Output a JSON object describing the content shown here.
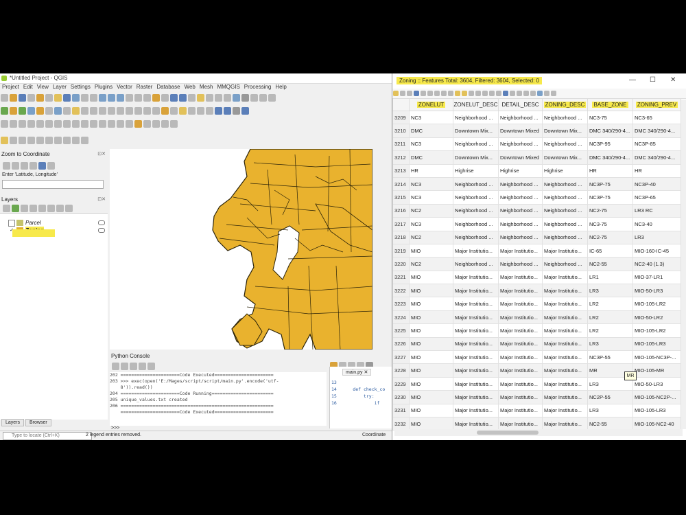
{
  "qgis": {
    "title": "*Untitled Project - QGIS",
    "menu": [
      "Project",
      "Edit",
      "View",
      "Layer",
      "Settings",
      "Plugins",
      "Vector",
      "Raster",
      "Database",
      "Web",
      "Mesh",
      "MMQGIS",
      "Processing",
      "Help"
    ],
    "zoom_panel_title": "Zoom to Coordinate",
    "zoom_input_label": "Enter 'Latitude, Longitude'",
    "layers_panel_title": "Layers",
    "layers": [
      {
        "name": "Parcel",
        "checked": false,
        "color": "#c4c36a"
      },
      {
        "name": "Zoning",
        "checked": true,
        "color": "#e2b22c"
      }
    ],
    "tabs": [
      "Layers",
      "Browser"
    ],
    "locator_placeholder": "Type to locate (Ctrl+K)",
    "status_message": "2 legend entries removed.",
    "coordinate_label": "Coordinate",
    "python_console_title": "Python Console",
    "console_lines": [
      "202 ======================Code Executed======================",
      "203 >>> exec(open('E:/Mages/script/script/main.py'.encode('utf-",
      "    8')).read())",
      "204 ======================Code Running=======================",
      "205 unique_values.txt created",
      "206 =========================================================",
      "    ======================Code Executed======================"
    ],
    "console_prompt": ">>>",
    "editor_tab": "main.py",
    "editor_lines": [
      "13",
      "14      def check_co",
      "15          try:",
      "16              if"
    ],
    "map_fill": "#e9b22e"
  },
  "attr": {
    "title": "Zoning :: Features Total: 3604, Filtered: 3604, Selected: 0",
    "columns": [
      "ZONELUT",
      "ZONELUT_DESC",
      "DETAIL_DESC",
      "ZONING_DESC",
      "BASE_ZONE",
      "ZONING_PREV"
    ],
    "highlighted_columns": [
      0,
      3,
      4,
      5
    ],
    "rows": [
      [
        "3209",
        "NC3",
        "Neighborhood ...",
        "Neighborhood ...",
        "Neighborhood ...",
        "NC3-75",
        "NC3-65"
      ],
      [
        "3210",
        "DMC",
        "Downtown Mix...",
        "Downtown Mixed",
        "Downtown Mix...",
        "DMC 340/290-4...",
        "DMC 340/290-4..."
      ],
      [
        "3211",
        "NC3",
        "Neighborhood ...",
        "Neighborhood ...",
        "Neighborhood ...",
        "NC3P-95",
        "NC3P-85"
      ],
      [
        "3212",
        "DMC",
        "Downtown Mix...",
        "Downtown Mixed",
        "Downtown Mix...",
        "DMC 340/290-4...",
        "DMC 340/290-4..."
      ],
      [
        "3213",
        "HR",
        "Highrise",
        "Highrise",
        "Highrise",
        "HR",
        "HR"
      ],
      [
        "3214",
        "NC3",
        "Neighborhood ...",
        "Neighborhood ...",
        "Neighborhood ...",
        "NC3P-75",
        "NC3P-40"
      ],
      [
        "3215",
        "NC3",
        "Neighborhood ...",
        "Neighborhood ...",
        "Neighborhood ...",
        "NC3P-75",
        "NC3P-65"
      ],
      [
        "3216",
        "NC2",
        "Neighborhood ...",
        "Neighborhood ...",
        "Neighborhood ...",
        "NC2-75",
        "LR3 RC"
      ],
      [
        "3217",
        "NC3",
        "Neighborhood ...",
        "Neighborhood ...",
        "Neighborhood ...",
        "NC3-75",
        "NC3-40"
      ],
      [
        "3218",
        "NC2",
        "Neighborhood ...",
        "Neighborhood ...",
        "Neighborhood ...",
        "NC2-75",
        "LR3"
      ],
      [
        "3219",
        "MIO",
        "Major Institutio...",
        "Major Institutio...",
        "Major Institutio...",
        "IC-65",
        "MIO-160-IC-45"
      ],
      [
        "3220",
        "NC2",
        "Neighborhood ...",
        "Neighborhood ...",
        "Neighborhood ...",
        "NC2-55",
        "NC2-40 (1.3)"
      ],
      [
        "3221",
        "MIO",
        "Major Institutio...",
        "Major Institutio...",
        "Major Institutio...",
        "LR1",
        "MIO-37-LR1"
      ],
      [
        "3222",
        "MIO",
        "Major Institutio...",
        "Major Institutio...",
        "Major Institutio...",
        "LR3",
        "MIO-50-LR3"
      ],
      [
        "3223",
        "MIO",
        "Major Institutio...",
        "Major Institutio...",
        "Major Institutio...",
        "LR2",
        "MIO-105-LR2"
      ],
      [
        "3224",
        "MIO",
        "Major Institutio...",
        "Major Institutio...",
        "Major Institutio...",
        "LR2",
        "MIO-50-LR2"
      ],
      [
        "3225",
        "MIO",
        "Major Institutio...",
        "Major Institutio...",
        "Major Institutio...",
        "LR2",
        "MIO-105-LR2"
      ],
      [
        "3226",
        "MIO",
        "Major Institutio...",
        "Major Institutio...",
        "Major Institutio...",
        "LR3",
        "MIO-105-LR3"
      ],
      [
        "3227",
        "MIO",
        "Major Institutio...",
        "Major Institutio...",
        "Major Institutio...",
        "NC3P-55",
        "MIO-105-NC3P-..."
      ],
      [
        "3228",
        "MIO",
        "Major Institutio...",
        "Major Institutio...",
        "Major Institutio...",
        "MR",
        "MIO-105-MR"
      ],
      [
        "3229",
        "MIO",
        "Major Institutio...",
        "Major Institutio...",
        "Major Institutio...",
        "LR3",
        "MIO-50-LR3"
      ],
      [
        "3230",
        "MIO",
        "Major Institutio...",
        "Major Institutio...",
        "Major Institutio...",
        "NC2P-55",
        "MIO-105-NC2P-..."
      ],
      [
        "3231",
        "MIO",
        "Major Institutio...",
        "Major Institutio...",
        "Major Institutio...",
        "LR3",
        "MIO-105-LR3"
      ],
      [
        "3232",
        "MIO",
        "Major Institutio...",
        "Major Institutio...",
        "Major Institutio...",
        "NC2-55",
        "MIO-105-NC2-40"
      ]
    ],
    "tooltip": "MR",
    "highlight_color": "#f7e94b"
  }
}
